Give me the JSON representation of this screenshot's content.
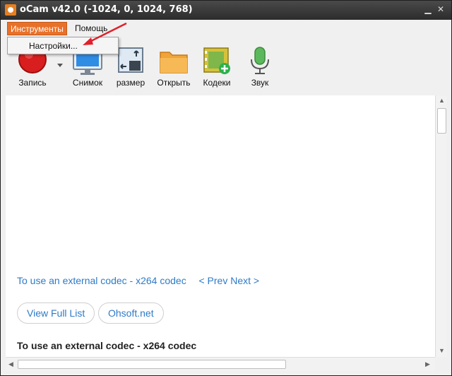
{
  "window": {
    "title": "oCam v42.0 (-1024, 0, 1024, 768)"
  },
  "menu": {
    "tools_label": "Инструменты",
    "help_label": "Помощь",
    "dropdown_settings": "Настройки..."
  },
  "toolbar": {
    "record_label": "Запись",
    "capture_label": "Снимок",
    "resize_label": "размер",
    "open_label": "Открыть",
    "codecs_label": "Кодеки",
    "sound_label": "Звук"
  },
  "content": {
    "codec_link": "To use an external codec - x264 codec",
    "prev_label": "< Prev",
    "next_label": "Next >",
    "view_full_list": "View Full List",
    "ohsoft": "Ohsoft.net",
    "heading": "To use an external codec - x264 codec"
  },
  "colors": {
    "accent": "#e8712a",
    "link": "#2e7bc6",
    "titlebar": "#2c2c2c"
  }
}
